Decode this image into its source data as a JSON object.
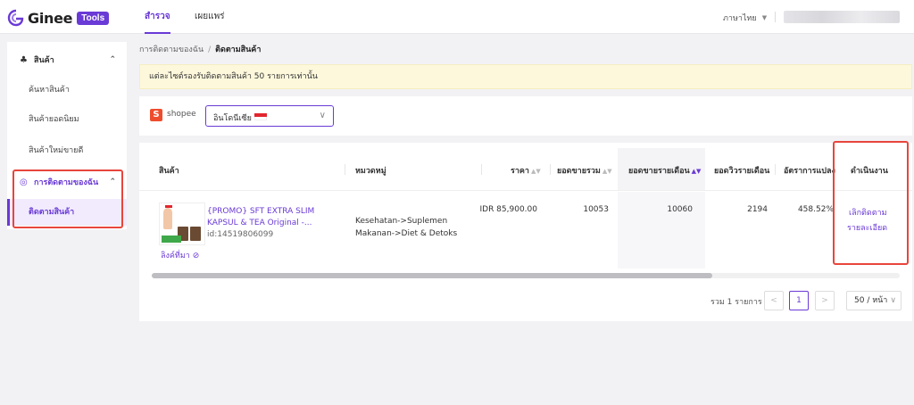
{
  "brand": {
    "name": "Ginee",
    "badge": "Tools",
    "accent": "#6a3ad6"
  },
  "topnav": {
    "tabs": [
      "สำรวจ",
      "เผยแพร่"
    ],
    "active": 0,
    "language": "ภาษาไทย"
  },
  "sidebar": {
    "group1": {
      "label": "สินค้า",
      "items": [
        "ค้นหาสินค้า",
        "สินค้ายอดนิยม",
        "สินค้าใหม่ขายดี"
      ]
    },
    "group2": {
      "label": "การติดตามของฉัน",
      "items": [
        "ติดตามสินค้า"
      ]
    }
  },
  "breadcrumb": {
    "parent": "การติดตามของฉัน",
    "separator": "/",
    "current": "ติดตามสินค้า"
  },
  "notice": "แต่ละไซต์รองรับติดตามสินค้า 50 รายการเท่านั้น",
  "filter": {
    "platform": "shopee",
    "country": "อินโดนีเซีย"
  },
  "table": {
    "columns": [
      "สินค้า",
      "หมวดหมู่",
      "ราคา",
      "ยอดขายรวม",
      "ยอดขายรายเดือน",
      "ยอดวิวรายเดือน",
      "อัตราการแปลง",
      "ดำเนินงาน"
    ],
    "rows": [
      {
        "title": "{PROMO} SFT EXTRA SLIM KAPSUL & TEA Original -...",
        "id": "id:14519806099",
        "link": "ลิงค์ที่มา",
        "category_1": "Kesehatan->Suplemen",
        "category_2": "Makanan->Diet & Detoks",
        "price": "IDR 85,900.00",
        "total_sales": "10053",
        "monthly_sales": "10060",
        "monthly_views": "2194",
        "conversion": "458.52%",
        "actions": [
          "เลิกติดตาม",
          "รายละเอียด"
        ]
      }
    ]
  },
  "pagination": {
    "total": "รวม 1 รายการ",
    "prev": "<",
    "current": "1",
    "next": ">",
    "page_size": "50 / หน้า"
  }
}
